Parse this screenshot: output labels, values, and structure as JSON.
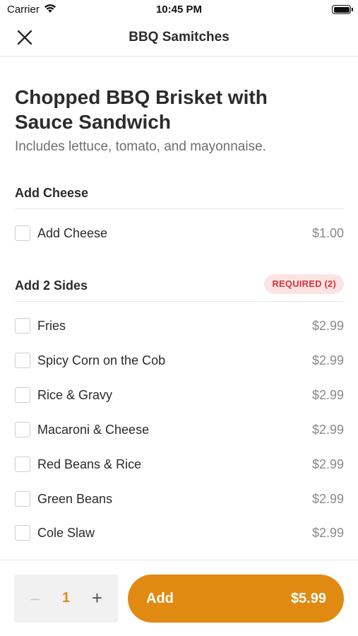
{
  "status_bar": {
    "carrier": "Carrier",
    "time": "10:45 PM"
  },
  "nav": {
    "title": "BBQ Samitches",
    "close_icon": "close-icon"
  },
  "item": {
    "title_line1": "Chopped BBQ Brisket with",
    "title_line2": "Sauce Sandwich",
    "description": "Includes lettuce, tomato, and mayonnaise."
  },
  "sections": [
    {
      "title": "Add Cheese",
      "badge": "",
      "options": [
        {
          "label": "Add Cheese",
          "price": "$1.00",
          "checked": false
        }
      ]
    },
    {
      "title": "Add 2 Sides",
      "badge": "REQUIRED (2)",
      "options": [
        {
          "label": "Fries",
          "price": "$2.99",
          "checked": false
        },
        {
          "label": "Spicy Corn on the Cob",
          "price": "$2.99",
          "checked": false
        },
        {
          "label": "Rice & Gravy",
          "price": "$2.99",
          "checked": false
        },
        {
          "label": "Macaroni & Cheese",
          "price": "$2.99",
          "checked": false
        },
        {
          "label": "Red Beans & Rice",
          "price": "$2.99",
          "checked": false
        },
        {
          "label": "Green Beans",
          "price": "$2.99",
          "checked": false
        },
        {
          "label": "Cole Slaw",
          "price": "$2.99",
          "checked": false
        }
      ]
    }
  ],
  "footer": {
    "quantity": "1",
    "minus": "−",
    "plus": "+",
    "add_label": "Add",
    "add_price": "$5.99"
  },
  "colors": {
    "accent": "#e08a12",
    "badge_bg": "#fde4e4",
    "badge_text": "#d6343a"
  }
}
